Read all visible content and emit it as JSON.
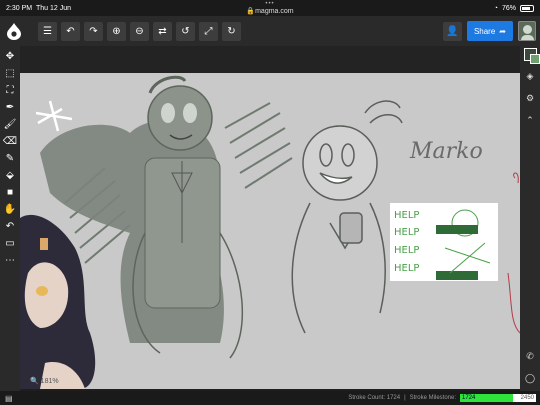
{
  "status": {
    "time": "2:30 PM",
    "day": "Thu 12 Jun",
    "dots": "•••",
    "url": "magma.com",
    "battery": "76%",
    "battery_level": 0.76
  },
  "toolbar": {
    "buttons": [
      {
        "name": "menu-button",
        "icon": "menu-icon",
        "glyph": "☰"
      },
      {
        "name": "undo-button",
        "icon": "undo-icon",
        "glyph": "↶"
      },
      {
        "name": "redo-button",
        "icon": "redo-icon",
        "glyph": "↷"
      },
      {
        "name": "zoom-in-button",
        "icon": "zoom-in-icon",
        "glyph": "⊕"
      },
      {
        "name": "zoom-out-button",
        "icon": "zoom-out-icon",
        "glyph": "⊖"
      },
      {
        "name": "flip-button",
        "icon": "flip-icon",
        "glyph": "⇄"
      },
      {
        "name": "rotate-left-button",
        "icon": "rotate-left-icon",
        "glyph": "↺"
      },
      {
        "name": "fit-button",
        "icon": "expand-icon",
        "glyph": "⤢"
      },
      {
        "name": "rotate-right-button",
        "icon": "rotate-right-icon",
        "glyph": "↻"
      }
    ],
    "share_label": "Share",
    "share_icon": "share-arrow-icon",
    "share_color": "#1e7ae3"
  },
  "left_tools": [
    {
      "name": "move-tool",
      "icon": "move-icon",
      "glyph": "✥"
    },
    {
      "name": "selection-tool",
      "icon": "marquee-icon",
      "glyph": "⬚"
    },
    {
      "name": "transform-tool",
      "icon": "transform-icon",
      "glyph": "⛶"
    },
    {
      "name": "eyedropper-tool",
      "icon": "eyedropper-icon",
      "glyph": "✒"
    },
    {
      "name": "brush-tool",
      "icon": "brush-icon",
      "glyph": "🖌"
    },
    {
      "name": "eraser-tool",
      "icon": "eraser-icon",
      "glyph": "⌫"
    },
    {
      "name": "pencil-tool",
      "icon": "pencil-icon",
      "glyph": "✎"
    },
    {
      "name": "fill-tool",
      "icon": "bucket-icon",
      "glyph": "⬙"
    },
    {
      "name": "shape-tool",
      "icon": "square-icon",
      "glyph": "■"
    },
    {
      "name": "hand-tool",
      "icon": "hand-icon",
      "glyph": "✋"
    },
    {
      "name": "undo-tool",
      "icon": "undo-icon",
      "glyph": "↶"
    },
    {
      "name": "chat-tool",
      "icon": "chat-icon",
      "glyph": "▭"
    },
    {
      "name": "more-tool",
      "icon": "more-icon",
      "glyph": "⋯"
    }
  ],
  "right_tools": [
    {
      "name": "layers-button",
      "icon": "layers-icon",
      "glyph": "◈"
    },
    {
      "name": "settings-button",
      "icon": "gear-icon",
      "glyph": "⚙"
    },
    {
      "name": "collapse-button",
      "icon": "chevron-up-icon",
      "glyph": "⌃"
    }
  ],
  "right_bottom": [
    {
      "name": "phone-button",
      "icon": "phone-icon",
      "glyph": "✆"
    },
    {
      "name": "chat-bubble-button",
      "icon": "chat-bubble-icon",
      "glyph": "◯"
    }
  ],
  "canvas": {
    "zoom": "181%",
    "signature": "Marko",
    "sign_lines": [
      "HELP",
      "HELP",
      "HELP",
      "HELP"
    ]
  },
  "colors": {
    "primary": "#3a4a3a",
    "secondary": "#6fa06f"
  },
  "bottom": {
    "stroke_count_label": "Stroke Count: 1724",
    "milestone_label": "Stroke Milestone:",
    "milestone_current": "1724",
    "milestone_target": "2450",
    "milestone_fraction": 0.7
  }
}
